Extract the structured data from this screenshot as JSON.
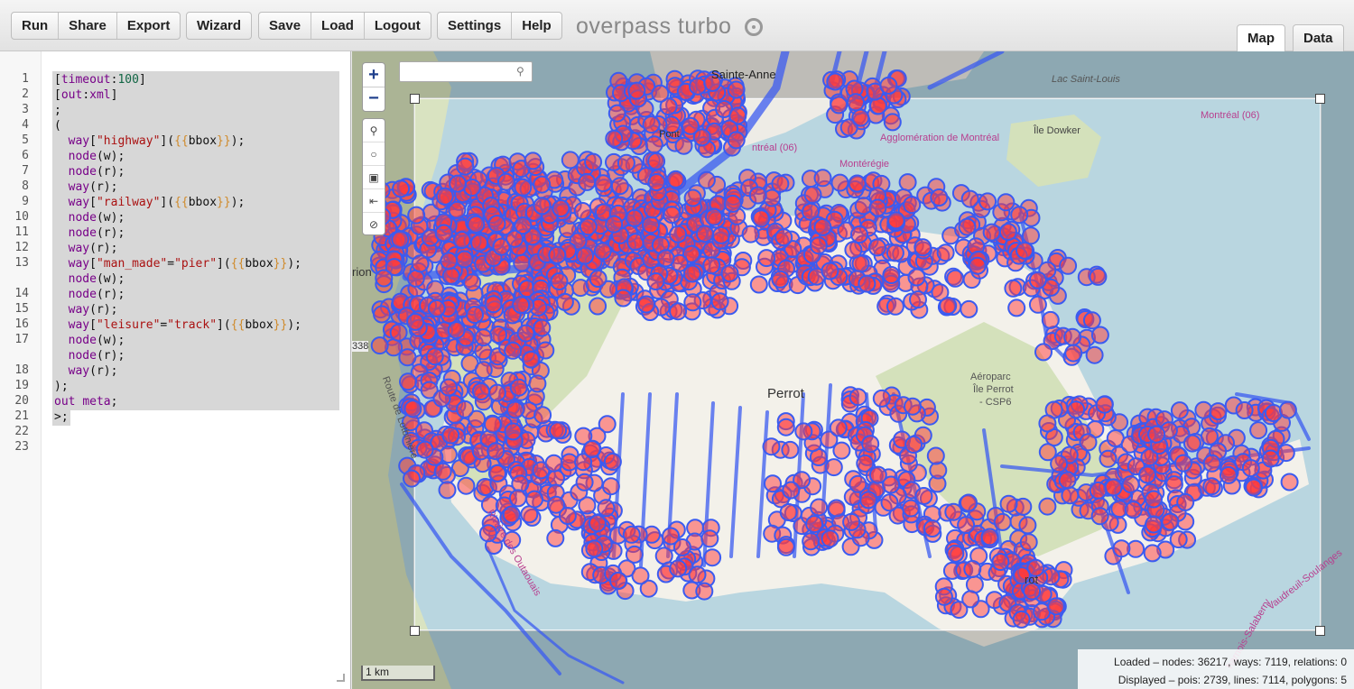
{
  "toolbar": {
    "group1": [
      "Run",
      "Share",
      "Export"
    ],
    "group2": [
      "Wizard"
    ],
    "group3": [
      "Save",
      "Load",
      "Logout"
    ],
    "group4": [
      "Settings",
      "Help"
    ],
    "brand": "overpass turbo",
    "tabs": {
      "map": "Map",
      "data": "Data"
    },
    "active_tab": "Map"
  },
  "editor": {
    "line_numbers": [
      "1",
      "2",
      "3",
      "4",
      "5",
      "6",
      "7",
      "8",
      "9",
      "10",
      "11",
      "12",
      "13",
      "14",
      "15",
      "16",
      "17",
      "18",
      "19",
      "20",
      "21",
      "22",
      "23"
    ]
  },
  "map": {
    "labels": {
      "sainte_anne": "Sainte-Anne",
      "lac_saint_louis": "Lac Saint-Louis",
      "montreal_06": "Montréal (06)",
      "agglo": "Agglomération de Montréal",
      "ile_dowker": "Île Dowker",
      "monteregie": "Montérégie",
      "montreal_06b": "ntréal (06)",
      "perrot": "Perrot",
      "aeroparc": "Aéroparc",
      "ile_perrot": "Île Perrot",
      "csp6": "- CSP6",
      "vaudreuil": "Vaudreuil-Soulanges",
      "beaharnois": "harnois-Salaberry",
      "route_lotbiniere": "Route de Lotbinière",
      "riviere_outaouais": "Rivière des Outaouais",
      "rion": "rion",
      "r338": "338",
      "pont": "Pont",
      "rot": "rot"
    },
    "search_placeholder": "",
    "scale": "1 km",
    "stats": {
      "loaded": "Loaded – nodes: 36217, ways: 7119, relations: 0",
      "displayed": "Displayed – pois: 2739, lines: 7114, polygons: 5"
    },
    "colors": {
      "water": "#a6cbd8",
      "land": "#f1eee7",
      "green": "#c8d9a8",
      "way": "#3b5bf0",
      "poi_fill": "#ff3a3a"
    }
  }
}
